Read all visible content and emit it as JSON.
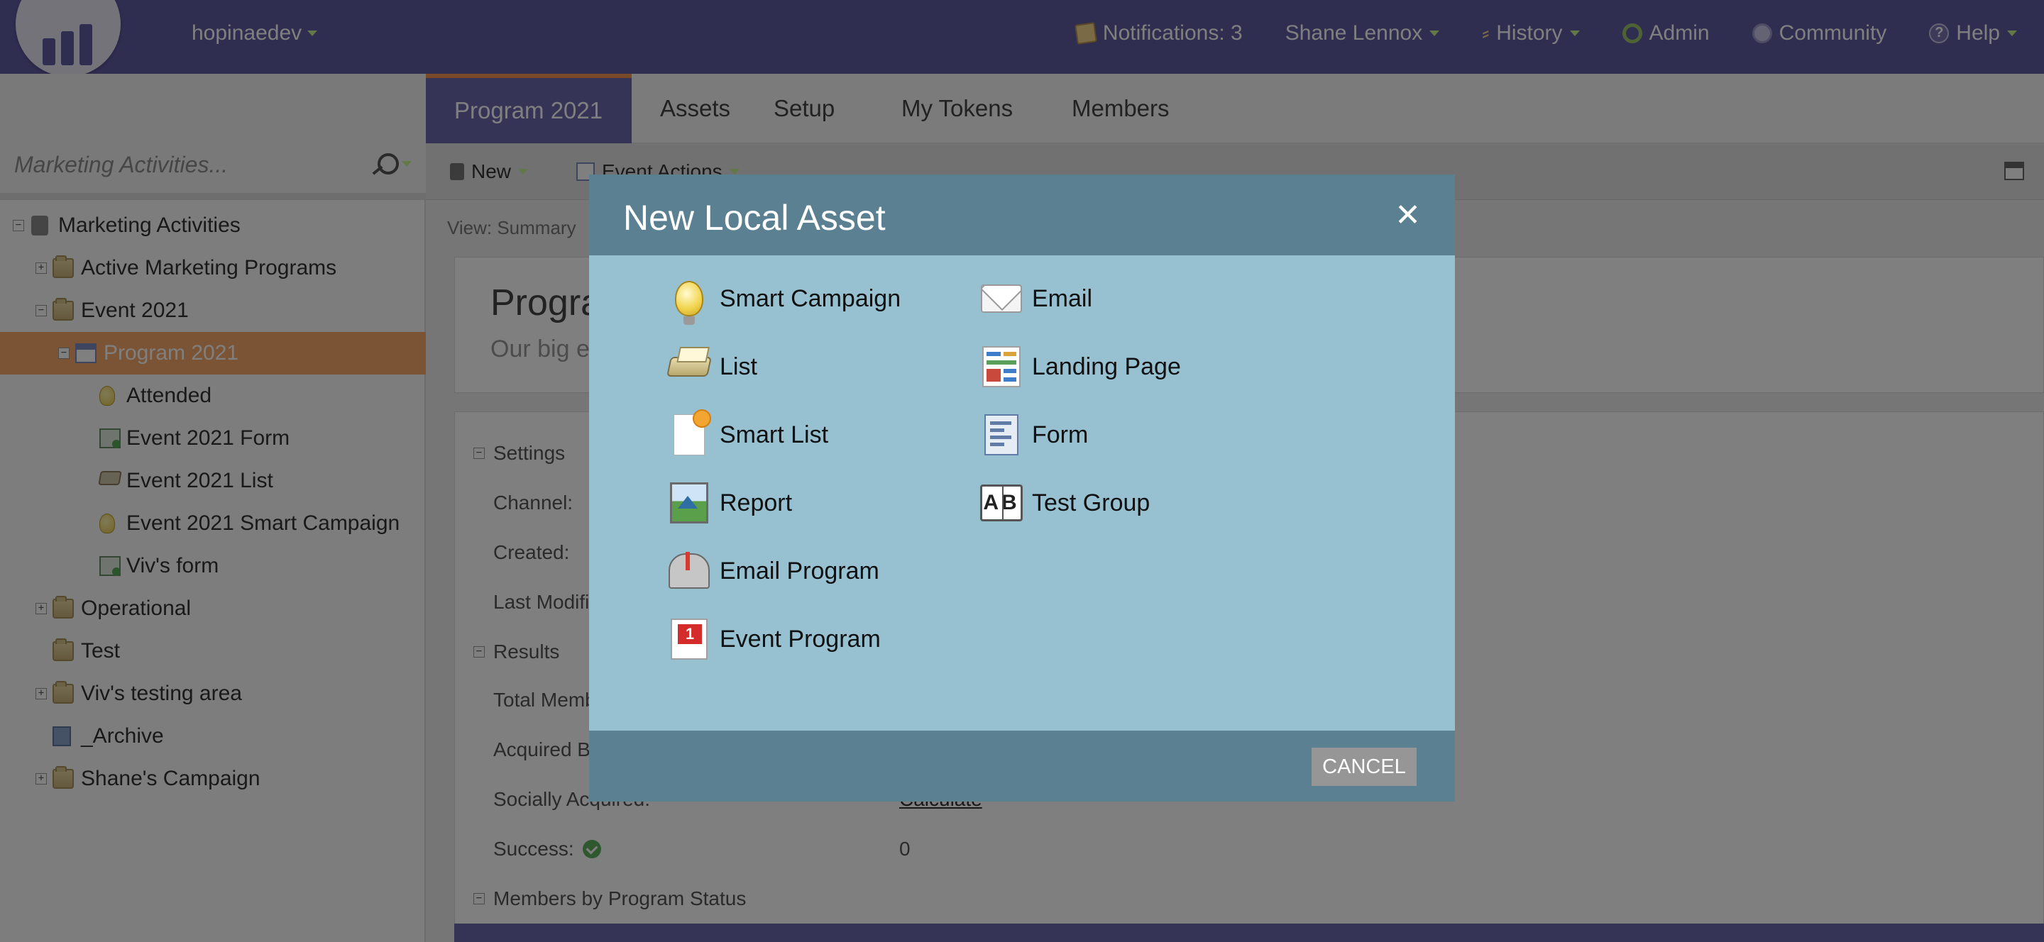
{
  "header": {
    "workspace": "hopinaedev",
    "nav": [
      {
        "id": "notifications",
        "label": "Notifications: 3",
        "icon": "note-icon"
      },
      {
        "id": "user",
        "label": "Shane Lennox",
        "icon": ""
      },
      {
        "id": "history",
        "label": "History",
        "icon": "history-icon"
      },
      {
        "id": "admin",
        "label": "Admin",
        "icon": "gear-icon"
      },
      {
        "id": "community",
        "label": "Community",
        "icon": "community-icon"
      },
      {
        "id": "help",
        "label": "Help",
        "icon": "help-icon"
      }
    ]
  },
  "sidebar": {
    "search_placeholder": "Marketing Activities...",
    "tree": [
      {
        "label": "Marketing Activities",
        "level": 0,
        "expander": "minus",
        "icon": "activities-icon"
      },
      {
        "label": "Active Marketing Programs",
        "level": 1,
        "expander": "plus",
        "icon": "folder-icon"
      },
      {
        "label": "Event 2021",
        "level": 1,
        "expander": "minus",
        "icon": "folder-icon"
      },
      {
        "label": "Program 2021",
        "level": 2,
        "expander": "minus",
        "icon": "calendar-icon",
        "selected": true
      },
      {
        "label": "Attended",
        "level": 3,
        "expander": "",
        "icon": "bulb-icon"
      },
      {
        "label": "Event 2021 Form",
        "level": 3,
        "expander": "",
        "icon": "form-icon"
      },
      {
        "label": "Event 2021 List",
        "level": 3,
        "expander": "",
        "icon": "list-icon"
      },
      {
        "label": "Event 2021 Smart Campaign",
        "level": 3,
        "expander": "",
        "icon": "bulb-icon"
      },
      {
        "label": "Viv's form",
        "level": 3,
        "expander": "",
        "icon": "form-icon"
      },
      {
        "label": "Operational",
        "level": 1,
        "expander": "plus",
        "icon": "folder-icon"
      },
      {
        "label": "Test",
        "level": 1,
        "expander": "",
        "icon": "folder-icon"
      },
      {
        "label": "Viv's testing area",
        "level": 1,
        "expander": "plus",
        "icon": "folder-icon"
      },
      {
        "label": "_Archive",
        "level": 1,
        "expander": "",
        "icon": "archive-icon"
      },
      {
        "label": "Shane's Campaign",
        "level": 1,
        "expander": "plus",
        "icon": "folder-icon"
      }
    ]
  },
  "main": {
    "tabs": [
      "Program 2021",
      "Assets",
      "Setup",
      "My Tokens",
      "Members"
    ],
    "toolbar": {
      "new_label": "New",
      "event_actions_label": "Event Actions"
    },
    "view_label": "View: Summary",
    "program_title": "Progra",
    "program_subtitle": "Our big e",
    "settings_label": "Settings",
    "fields_settings": [
      "Channel:",
      "Created:",
      "Last Modifi"
    ],
    "results_label": "Results",
    "fields_results": [
      "Total Memb",
      "Acquired By",
      "Socially Acquired:",
      "Success:"
    ],
    "calculate_label": "Calculate",
    "success_value": "0",
    "members_status_label": "Members by Program Status"
  },
  "modal": {
    "title": "New Local Asset",
    "close_label": "✕",
    "cancel_label": "CANCEL",
    "left_column": [
      {
        "label": "Smart Campaign",
        "icon": "lightbulb-icon"
      },
      {
        "label": "List",
        "icon": "list-tray-icon"
      },
      {
        "label": "Smart List",
        "icon": "smart-list-icon"
      },
      {
        "label": "Report",
        "icon": "report-icon"
      },
      {
        "label": "Email Program",
        "icon": "mailbox-icon"
      },
      {
        "label": "Event Program",
        "icon": "event-calendar-icon"
      }
    ],
    "right_column": [
      {
        "label": "Email",
        "icon": "envelope-icon"
      },
      {
        "label": "Landing Page",
        "icon": "landing-page-icon"
      },
      {
        "label": "Form",
        "icon": "form-icon"
      },
      {
        "label": "Test Group",
        "icon": "ab-test-icon"
      }
    ]
  },
  "colors": {
    "header_bg": "#5f5aa0",
    "selected_row": "#f6a96a",
    "modal_header": "#5a8092",
    "modal_body": "#97c1d1",
    "accent": "#f29350"
  }
}
